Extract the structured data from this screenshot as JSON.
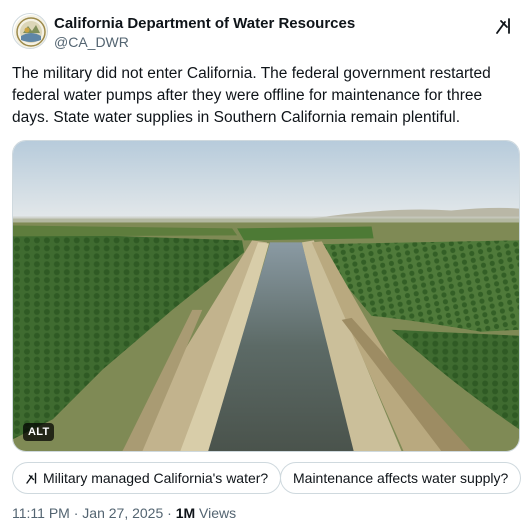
{
  "account": {
    "display_name": "California Department of Water Resources",
    "handle": "@CA_DWR",
    "avatar_icon": "state-seal-icon"
  },
  "post": {
    "text": "The military did not enter California. The federal government restarted federal water pumps after they were offline for maintenance for three days. State water supplies in Southern California remain plentiful.",
    "alt_badge": "ALT",
    "image_icon": "aqueduct-photo"
  },
  "grok_chips": [
    {
      "label": "Military managed California's water?",
      "icon": "grok-icon"
    },
    {
      "label": "Maintenance affects water supply?"
    }
  ],
  "meta": {
    "time": "11:11 PM · Jan 27, 2025 · ",
    "views_count": "1M",
    "views_label": " Views"
  },
  "colors": {
    "text_primary": "#0f1419",
    "text_secondary": "#536471",
    "border": "#cfd9de"
  }
}
